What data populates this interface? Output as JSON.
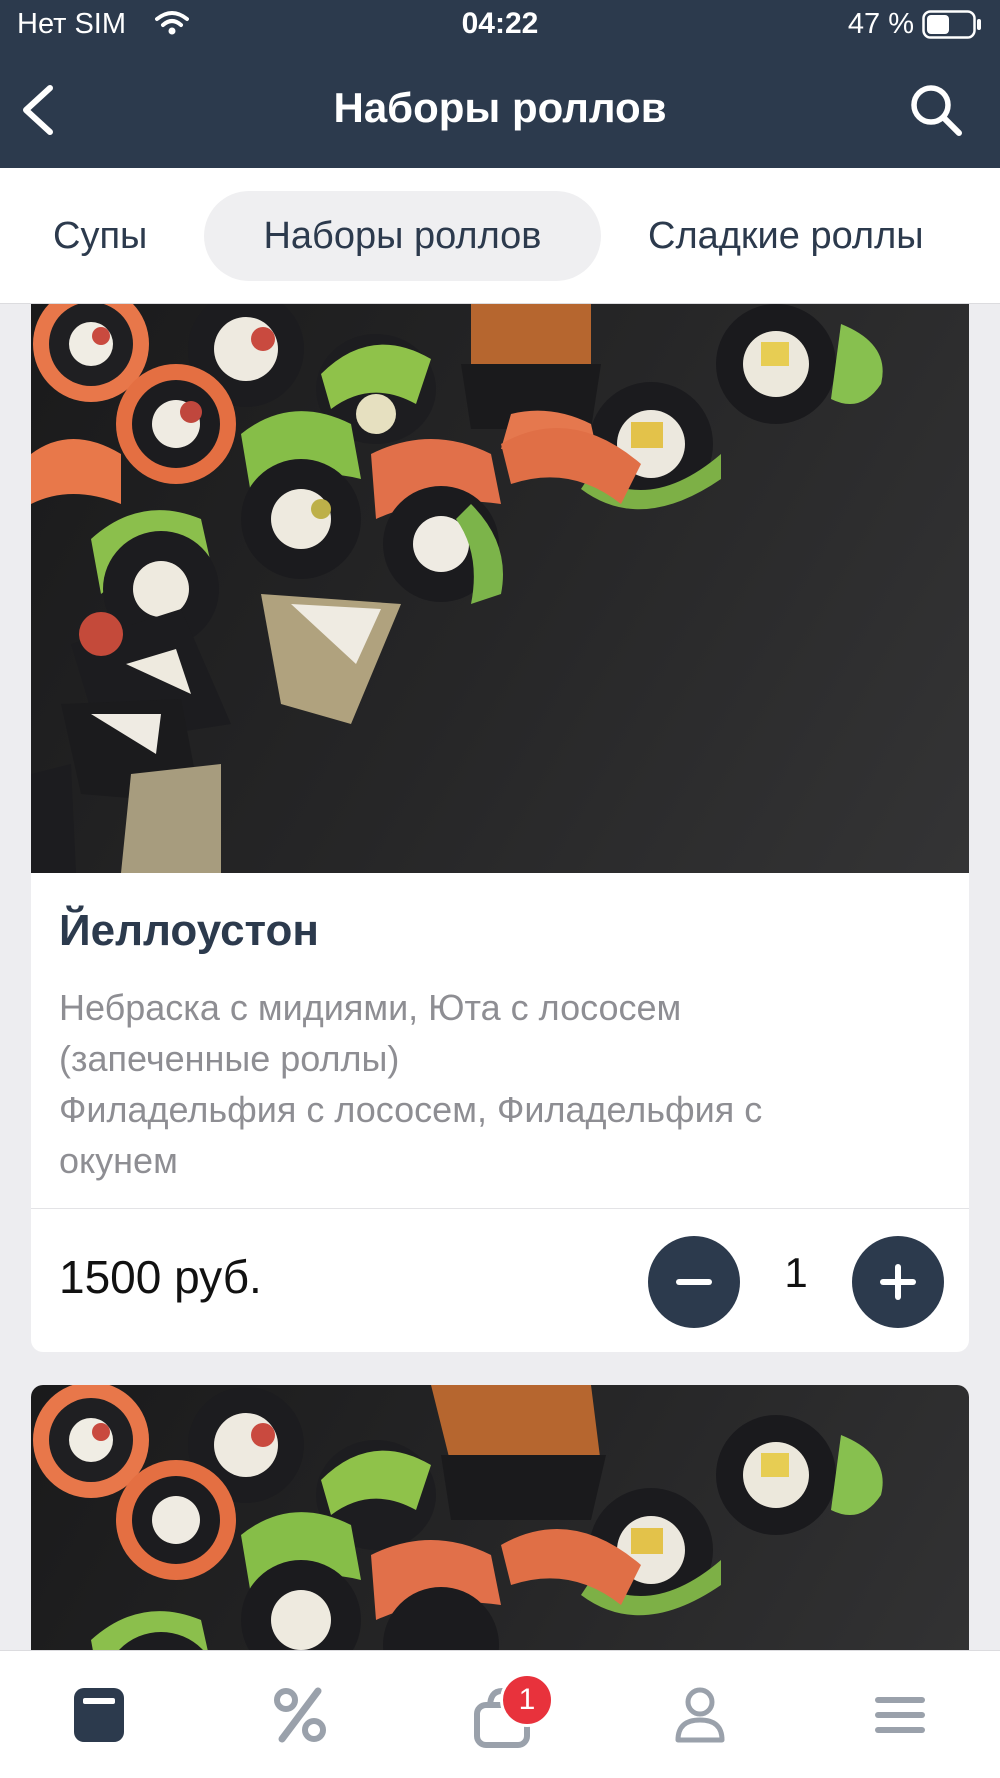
{
  "status_bar": {
    "carrier": "Нет SIM",
    "time": "04:22",
    "battery": "47 %"
  },
  "header": {
    "title": "Наборы роллов",
    "back_icon": "chevron-left-icon",
    "search_icon": "search-icon"
  },
  "tabs": [
    {
      "label": "Супы",
      "active": false
    },
    {
      "label": "Наборы роллов",
      "active": true
    },
    {
      "label": "Сладкие роллы",
      "active": false
    }
  ],
  "products": [
    {
      "name": "Йеллоустон",
      "description_lines": [
        "Небраска с мидиями, Юта с лососем",
        "(запеченные роллы)",
        "Филадельфия с лососем, Филадельфия с",
        "окунем"
      ],
      "price": "1500 руб.",
      "quantity": "1"
    },
    {
      "image": "sushi-set-photo"
    }
  ],
  "bottom_nav": [
    {
      "icon": "menu-catalog-icon",
      "active": true
    },
    {
      "icon": "percent-icon",
      "active": false
    },
    {
      "icon": "cart-icon",
      "badge": "1",
      "active": false
    },
    {
      "icon": "profile-icon",
      "active": false
    },
    {
      "icon": "hamburger-menu-icon",
      "active": false
    }
  ],
  "colors": {
    "header_bg": "#2c3a4d",
    "accent": "#2c3a4d",
    "badge": "#e8323c",
    "muted_text": "#8e8e93"
  }
}
